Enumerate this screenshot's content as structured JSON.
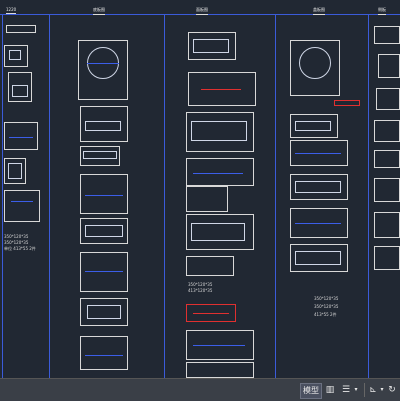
{
  "columns": [
    {
      "id": "col1",
      "label": "1220"
    },
    {
      "id": "col2",
      "label": "底板图"
    },
    {
      "id": "col3",
      "label": "面板图"
    },
    {
      "id": "col4",
      "label": "盖板图"
    },
    {
      "id": "col5",
      "label": "侧板"
    }
  ],
  "notes": {
    "col1_spec_a": "350*120*35",
    "col1_spec_b": "350*120*35",
    "col1_unit": "单位  413*55 2件",
    "col3_spec_a": "350*120*35",
    "col3_spec_b": "413*120*35",
    "col4_spec_a": "350*120*35",
    "col4_spec_b": "350*120*35",
    "col4_spec_c": "413*55 2件"
  },
  "statusbar": {
    "model_label": "模型",
    "grid_icon": "grid-icon",
    "menu_icon": "hamburger-icon",
    "snap_icon": "snap-icon",
    "orbit_icon": "orbit-icon"
  },
  "colors": {
    "background": "#212833",
    "frame_line": "#3b5bd9",
    "drawing_line": "#d8d8d8",
    "dimension": "#3c5ee8",
    "highlight": "#e03030",
    "statusbar": "#3a3f47"
  }
}
